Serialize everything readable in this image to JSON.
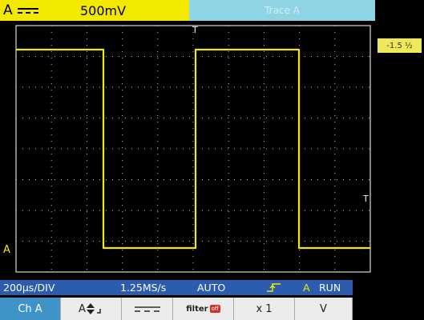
{
  "channel": {
    "name": "A",
    "scale": "500mV",
    "coupling_icon": "dc-coupling-icon",
    "color": "#f2e800",
    "ground_marker": "A"
  },
  "trace_info": "Trace A",
  "trigger": {
    "level_label": "-1.5 ½",
    "position_marker": "T",
    "level_marker": "T"
  },
  "status": {
    "timebase": "200µs/DIV",
    "sample_rate": "1.25MS/s",
    "mode": "AUTO",
    "edge_icon": "rising-edge-icon",
    "trigger_source": "A",
    "run_state": "RUN"
  },
  "softkeys": {
    "channel": "Ch A",
    "position": "A",
    "coupling_icon": "dc-coupling-icon",
    "filter": "filter",
    "filter_state": "off",
    "probe": "x 1",
    "mode": "V"
  },
  "colors": {
    "trace": "#f2e800",
    "status_bar": "#2c5cae",
    "channel_softkey": "#3f93c6",
    "trace_info_bg": "#8fd4e3"
  }
}
